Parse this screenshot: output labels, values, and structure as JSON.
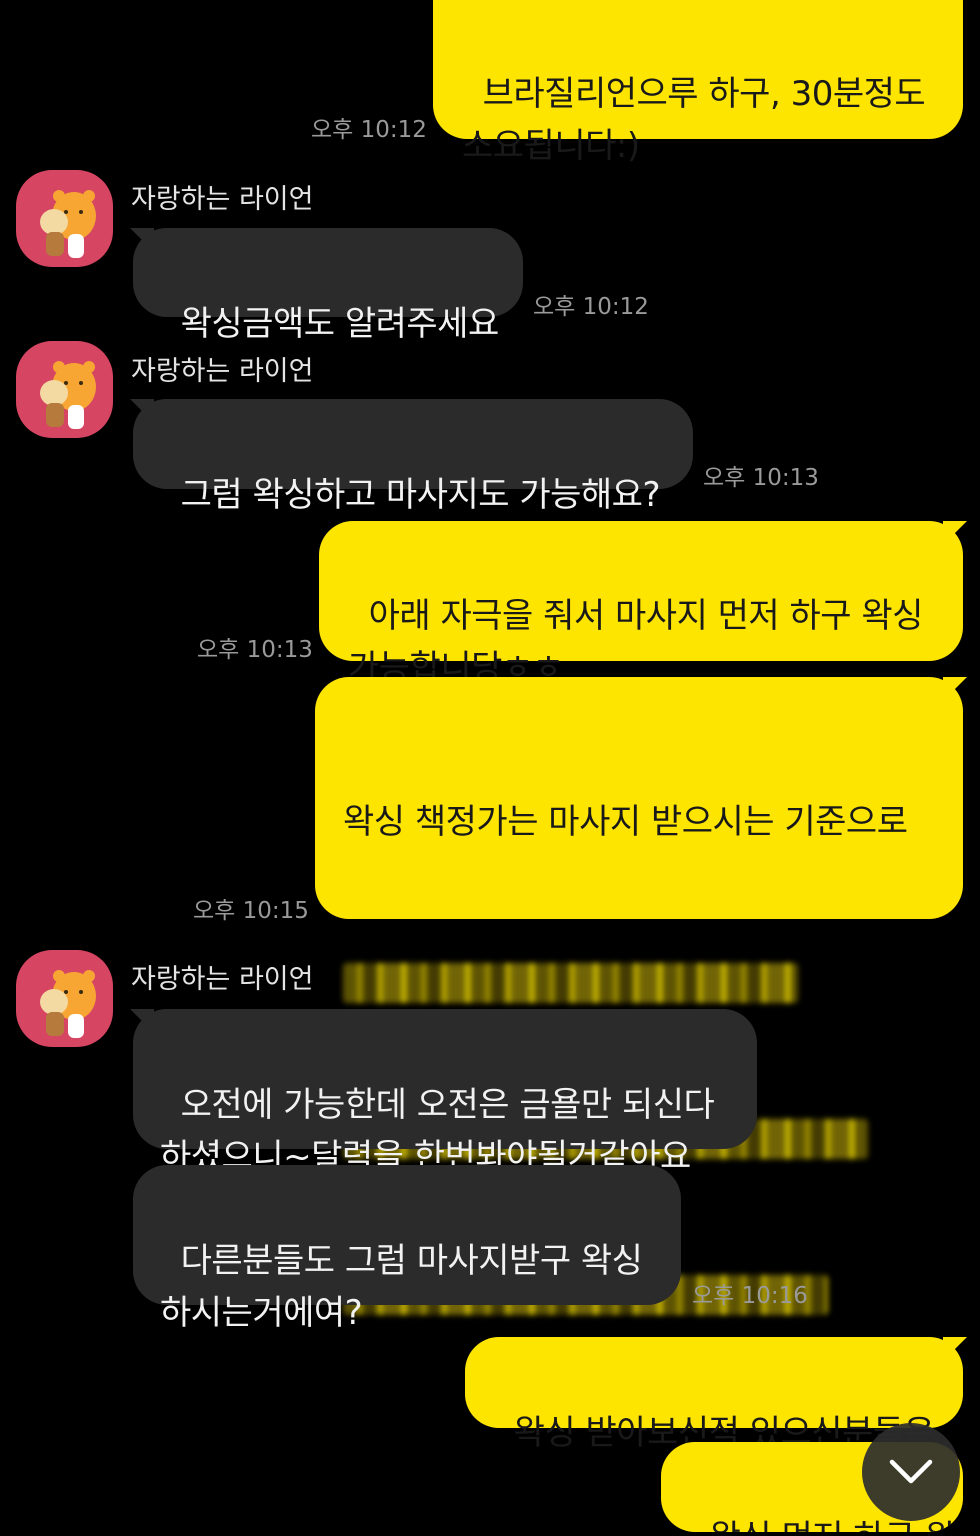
{
  "messages": {
    "m1": {
      "text": "브라질리언으루 하구, 30분정도\n소요됩니다:)",
      "time": "오후 10:12"
    },
    "m2": {
      "sender": "자랑하는 라이언",
      "text": "왁싱금액도 알려주세요",
      "time": "오후 10:12"
    },
    "m3": {
      "sender": "자랑하는 라이언",
      "text": "그럼 왁싱하고 마사지도 가능해요?",
      "time": "오후 10:13"
    },
    "m4": {
      "text": "아래 자극을 줘서 마사지 먼저 하구 왁싱\n가능합니당ㅎㅎ",
      "time": "오후 10:13"
    },
    "m5": {
      "text": "왁싱 책정가는 마사지 받으시는 기준으로",
      "time": "오후 10:15"
    },
    "m6": {
      "sender": "자랑하는 라이언",
      "text": "오전에 가능한데 오전은 금욜만 되신다\n하셨으니~달력을 한번봐야될거같아요"
    },
    "m7": {
      "text": "다른분들도 그럼 마사지받구 왁싱\n하시는거에여?",
      "time": "오후 10:16"
    },
    "m8": {
      "text": "왁싱 받아보신적 있으신분들은"
    },
    "m9": {
      "text": "왁싱 먼저 하구 왕"
    }
  },
  "icons": {
    "avatar": "ryan-character-avatar",
    "scroll": "chevron-down-icon"
  },
  "colors": {
    "background": "#000000",
    "outgoing_bubble": "#FEE500",
    "incoming_bubble": "#2B2B2B",
    "avatar_bg": "#D64562"
  }
}
